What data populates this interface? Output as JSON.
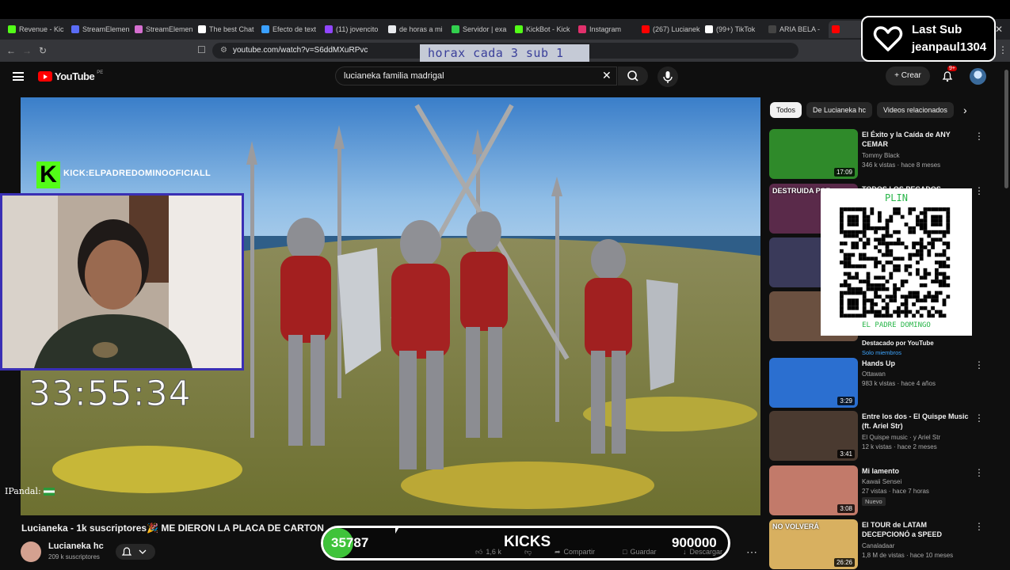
{
  "browser": {
    "tabs": [
      {
        "label": "Revenue - Kic",
        "color": "#53fc18"
      },
      {
        "label": "StreamElemen",
        "color": "#5a6cf5"
      },
      {
        "label": "StreamElemen",
        "color": "#d56fd0"
      },
      {
        "label": "The best Chat",
        "color": "#ffffff"
      },
      {
        "label": "Efecto de text",
        "color": "#3aa0ff"
      },
      {
        "label": "(11) jovencito",
        "color": "#9146ff"
      },
      {
        "label": "de horas a mi",
        "color": "#e8eaed"
      },
      {
        "label": "Servidor | exa",
        "color": "#32d04e"
      },
      {
        "label": "KickBot - Kick",
        "color": "#53fc18"
      },
      {
        "label": "Instagram",
        "color": "#e1306c"
      },
      {
        "label": "(267) Lucianek",
        "color": "#ff0000"
      },
      {
        "label": "(99+) TikTok",
        "color": "#ffffff"
      },
      {
        "label": "ARIA BELA -",
        "color": "#444444"
      },
      {
        "label": "",
        "color": "#ff0000"
      }
    ],
    "url": "youtube.com/watch?v=S6ddMXuRPvc"
  },
  "overlay": {
    "horax": "horax cada 3 sub  1",
    "last_sub_title": "Last Sub",
    "last_sub_user": "jeanpaul1304",
    "kick_handle": "KICK:ELPADREDOMINOOFICIALL",
    "timer": "33:55:34",
    "pandal": "IPandal:",
    "qr_top": "PLIN",
    "qr_bottom": "EL PADRE DOMINGO",
    "kicks": {
      "current": "35787",
      "label": "KICKS",
      "goal": "900000",
      "progress": 0.0398
    }
  },
  "youtube": {
    "logo": "YouTube",
    "logo_region": "PE",
    "search_query": "lucianeka familia madrigal",
    "create_label": "Crear",
    "notif_count": "9+",
    "video_title": "Lucianeka - 1k suscriptores🎉 ME DIERON LA PLACA DE CARTON",
    "channel_name": "Lucianeka hc",
    "subscribers": "209 k suscriptores",
    "likes": "1,6 k",
    "share": "Compartir",
    "save": "Guardar",
    "download": "Descargar",
    "chips": [
      "Todos",
      "De Lucianeka hc",
      "Videos relacionados"
    ],
    "recs": [
      {
        "title": "El Éxito y la Caída de ANY CEMAR",
        "channel": "Tommy Black",
        "meta": "346 k vistas · hace 8 meses",
        "duration": "17:09",
        "thumb": "#2f8a2a"
      },
      {
        "title": "TODOS LOS PECADOS",
        "channel": "",
        "meta": "",
        "duration": "",
        "thumb": "#5a2a4a",
        "thumb_text": "DESTRUIDA POR"
      },
      {
        "title": "",
        "channel": "",
        "meta": "",
        "duration": "",
        "thumb": "#3a3a5a"
      },
      {
        "title": "",
        "channel": "Destacado por YouTube",
        "meta": "Solo miembros",
        "duration": "",
        "thumb": "#6a5040"
      },
      {
        "title": "Hands Up",
        "channel": "Ottawan",
        "meta": "983 k vistas · hace 4 años",
        "duration": "3:29",
        "thumb": "#2b6fd0"
      },
      {
        "title": "Entre los dos - El Quispe Music (ft. Ariel Str)",
        "channel": "El Quispe music · y Ariel Str",
        "meta": "12 k vistas · hace 2 meses",
        "duration": "3:41",
        "thumb": "#4a3a30"
      },
      {
        "title": "Mi lamento",
        "channel": "Kawaii Sensei",
        "meta": "27 vistas · hace 7 horas",
        "duration": "3:08",
        "thumb": "#c27a6a",
        "badge": "Nuevo"
      },
      {
        "title": "El TOUR de LATAM DECEPCIONÓ a SPEED",
        "channel": "Canaladaar",
        "meta": "1,8 M de vistas · hace 10 meses",
        "duration": "26:26",
        "thumb": "#d8b060",
        "thumb_text": "NO VOLVERÁ"
      }
    ]
  }
}
